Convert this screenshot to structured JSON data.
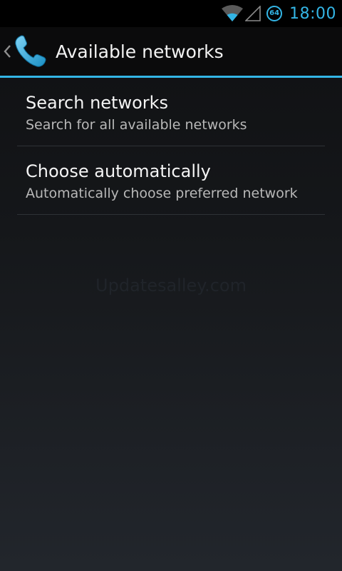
{
  "status_bar": {
    "time": "18:00",
    "battery_level": "64",
    "icons": [
      "wifi-icon",
      "signal-icon",
      "battery-icon"
    ],
    "accent_color": "#33b5e5"
  },
  "action_bar": {
    "title": "Available networks",
    "up_icon": "chevron-left-icon",
    "app_icon": "phone-icon"
  },
  "list": {
    "items": [
      {
        "title": "Search networks",
        "summary": "Search for all available networks"
      },
      {
        "title": "Choose automatically",
        "summary": "Automatically choose preferred network"
      }
    ]
  },
  "watermark": "Updatesalley.com"
}
